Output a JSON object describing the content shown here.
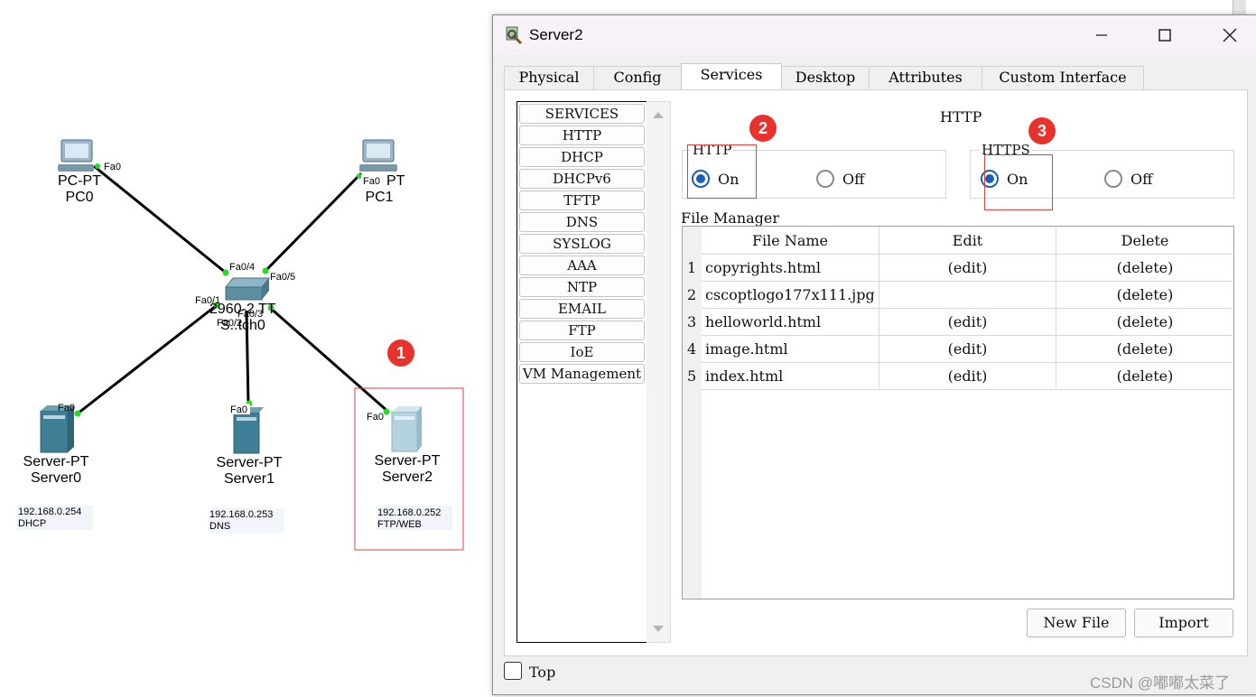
{
  "topology": {
    "pc0": {
      "type": "PC-PT",
      "name": "PC0",
      "port": "Fa0"
    },
    "pc1": {
      "type": "PC-PT",
      "name": "PC1",
      "port": "Fa0"
    },
    "switch": {
      "type": "2960-24TT",
      "name": "Switch0",
      "type_visible": "2960-2 TT",
      "name_visible": "S..tch0",
      "ports": [
        "Fa0/4",
        "Fa0/5",
        "Fa0/1",
        "Fa0/3",
        "Fa0/2"
      ]
    },
    "server0": {
      "type": "Server-PT",
      "name": "Server0",
      "port": "Fa0",
      "ip": "192.168.0.254",
      "role": "DHCP"
    },
    "server1": {
      "type": "Server-PT",
      "name": "Server1",
      "port": "Fa0",
      "ip": "192.168.0.253",
      "role": "DNS"
    },
    "server2": {
      "type": "Server-PT",
      "name": "Server2",
      "port": "Fa0",
      "ip": "192.168.0.252",
      "role": "FTP/WEB"
    }
  },
  "annotations": {
    "badge1": "1",
    "badge2": "2",
    "badge3": "3",
    "color": "#e8322d"
  },
  "window": {
    "title": "Server2",
    "title_icon": "server-wrench-icon",
    "controls": [
      "minimize-icon",
      "maximize-icon",
      "close-icon"
    ],
    "tabs": [
      "Physical",
      "Config",
      "Services",
      "Desktop",
      "Attributes",
      "Custom Interface"
    ],
    "active_tab": "Services",
    "services": [
      "SERVICES",
      "HTTP",
      "DHCP",
      "DHCPv6",
      "TFTP",
      "DNS",
      "SYSLOG",
      "AAA",
      "NTP",
      "EMAIL",
      "FTP",
      "IoE",
      "VM Management"
    ],
    "content": {
      "heading": "HTTP",
      "http": {
        "label": "HTTP",
        "on": "On",
        "off": "Off",
        "selected": "On"
      },
      "https": {
        "label": "HTTPS",
        "on": "On",
        "off": "Off",
        "selected": "On"
      },
      "file_manager": {
        "label": "File Manager",
        "columns": [
          "File Name",
          "Edit",
          "Delete"
        ],
        "rows": [
          {
            "num": "1",
            "name": "copyrights.html",
            "edit": "(edit)",
            "delete": "(delete)"
          },
          {
            "num": "2",
            "name": "cscoptlogo177x111.jpg",
            "edit": "",
            "delete": "(delete)"
          },
          {
            "num": "3",
            "name": "helloworld.html",
            "edit": "(edit)",
            "delete": "(delete)"
          },
          {
            "num": "4",
            "name": "image.html",
            "edit": "(edit)",
            "delete": "(delete)"
          },
          {
            "num": "5",
            "name": "index.html",
            "edit": "(edit)",
            "delete": "(delete)"
          }
        ]
      },
      "buttons": {
        "new_file": "New File",
        "import": "Import"
      }
    },
    "footer": {
      "top_label": "Top",
      "top_checked": false
    }
  },
  "watermark": "CSDN @嘟嘟太菜了",
  "colors": {
    "link": "#000000",
    "port_dot": "#22dd22",
    "radio_selected": "#1a5fb4",
    "device": "#3f7f96"
  }
}
